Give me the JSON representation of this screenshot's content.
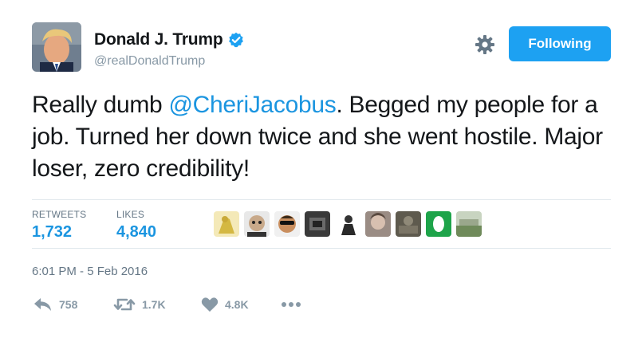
{
  "author": {
    "display_name": "Donald J. Trump",
    "handle": "@realDonaldTrump",
    "verified": true
  },
  "follow_button": {
    "label": "Following"
  },
  "tweet": {
    "text_before": "Really dumb ",
    "mention": "@CheriJacobus",
    "text_after": ". Begged my people for a job. Turned her down twice and she went hostile. Major loser, zero credibility!"
  },
  "stats": {
    "retweets_label": "RETWEETS",
    "retweets_value": "1,732",
    "likes_label": "LIKES",
    "likes_value": "4,840"
  },
  "timestamp": "6:01 PM - 5 Feb 2016",
  "actions": {
    "reply_count": "758",
    "retweet_count": "1.7K",
    "like_count": "4.8K"
  },
  "colors": {
    "accent": "#1da1f2",
    "link": "#1b95e0",
    "muted": "#8899a6"
  }
}
